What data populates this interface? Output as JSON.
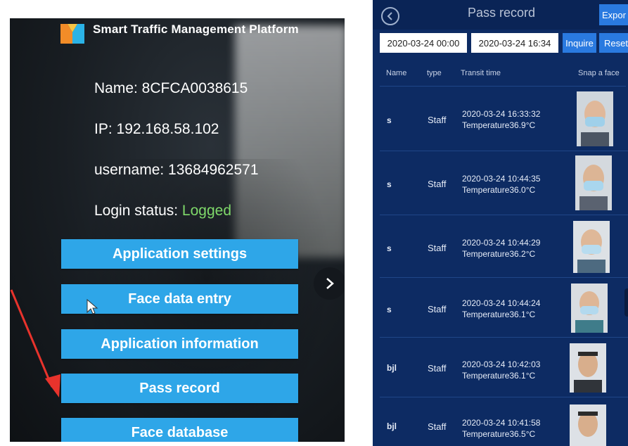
{
  "left_panel": {
    "platform_title": "Smart Traffic Management Platform",
    "name_line": "Name: 8CFCA0038615",
    "ip_line": "IP: 192.168.58.102",
    "username_line": "username: 13684962571",
    "login_status_label": "Login status: ",
    "login_status_value": "Logged",
    "menu": [
      "Application settings",
      "Face data entry",
      "Application information",
      "Pass record",
      "Face database"
    ]
  },
  "right_panel": {
    "title": "Pass record",
    "export_label": "Expor",
    "start_date": "2020-03-24 00:00",
    "end_date": "2020-03-24 16:34",
    "inquire_label": "Inquire",
    "reset_label": "Reset",
    "columns": [
      "Name",
      "type",
      "Transit time",
      "Snap a face"
    ],
    "rows": [
      {
        "name": "s",
        "type": "Staff",
        "time": "2020-03-24 16:33:32",
        "temperature": "Temperature36.9°C"
      },
      {
        "name": "s",
        "type": "Staff",
        "time": "2020-03-24 10:44:35",
        "temperature": "Temperature36.0°C"
      },
      {
        "name": "s",
        "type": "Staff",
        "time": "2020-03-24 10:44:29",
        "temperature": "Temperature36.2°C"
      },
      {
        "name": "s",
        "type": "Staff",
        "time": "2020-03-24 10:44:24",
        "temperature": "Temperature36.1°C"
      },
      {
        "name": "bjl",
        "type": "Staff",
        "time": "2020-03-24 10:42:03",
        "temperature": "Temperature36.1°C"
      },
      {
        "name": "bjl",
        "type": "Staff",
        "time": "2020-03-24 10:41:58",
        "temperature": "Temperature36.5°C"
      }
    ]
  },
  "colors": {
    "button_blue": "#2ea6e8",
    "status_green": "#7fd96a",
    "table_bg": "#0d2b63",
    "action_blue": "#2a7ae0",
    "arrow_red": "#e8332c"
  },
  "icons": [
    "logo-icon",
    "chevron-right-icon",
    "back-arrow-icon",
    "cursor-icon",
    "red-arrow-icon",
    "face-photo-icon"
  ]
}
